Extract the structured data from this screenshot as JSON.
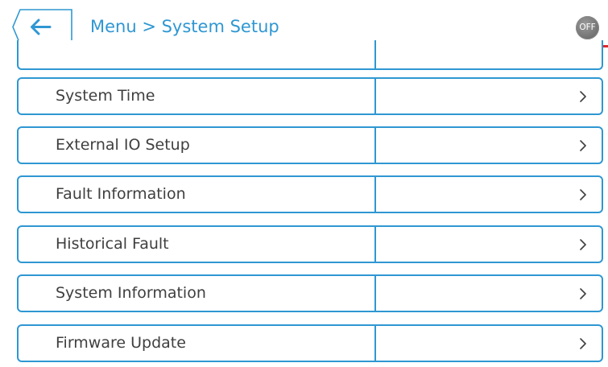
{
  "header": {
    "title": "Menu > System Setup",
    "toggle_label": "OFF",
    "back_icon": "back-arrow-icon"
  },
  "menu": {
    "items": [
      {
        "label": "System Time",
        "value": ""
      },
      {
        "label": "External IO Setup",
        "value": ""
      },
      {
        "label": "Fault Information",
        "value": ""
      },
      {
        "label": "Historical Fault",
        "value": ""
      },
      {
        "label": "System Information",
        "value": ""
      },
      {
        "label": "Firmware Update",
        "value": ""
      }
    ],
    "chevron_icon": "chevron-right-icon"
  },
  "colors": {
    "accent": "#2f97d2",
    "text": "#3f3f3f",
    "warning": "#e0262b",
    "toggle_off": "#7a7a7a"
  }
}
